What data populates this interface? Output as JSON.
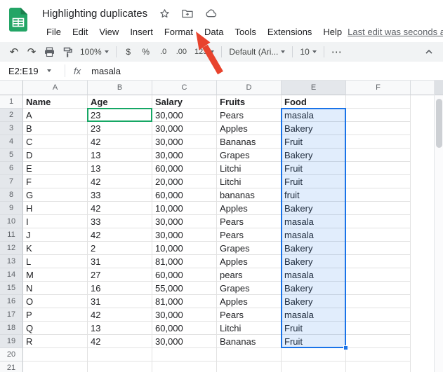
{
  "header": {
    "title": "Highlighting duplicates",
    "last_edit": "Last edit was seconds ago"
  },
  "menus": [
    "File",
    "Edit",
    "View",
    "Insert",
    "Format",
    "Data",
    "Tools",
    "Extensions",
    "Help"
  ],
  "icons": {
    "undo": "↶",
    "redo": "↷",
    "more": "⋯"
  },
  "toolbar": {
    "zoom": "100%",
    "currency": "$",
    "percent": "%",
    "decrease_decimal": ".0",
    "increase_decimal": ".00",
    "number_format": "123",
    "font": "Default (Ari...",
    "font_size": "10"
  },
  "formula_bar": {
    "name_box": "E2:E19",
    "fx_label": "fx",
    "value": "masala"
  },
  "sheet": {
    "column_letters": [
      "A",
      "B",
      "C",
      "D",
      "E",
      "F"
    ],
    "visible_rows": 21,
    "headers": [
      "Name",
      "Age",
      "Salary",
      "Fruits",
      "Food"
    ],
    "rows": [
      [
        "A",
        "23",
        "30,000",
        "Pears",
        "masala"
      ],
      [
        "B",
        "23",
        "30,000",
        "Apples",
        "Bakery"
      ],
      [
        "C",
        "42",
        "30,000",
        "Bananas",
        "Fruit"
      ],
      [
        "D",
        "13",
        "30,000",
        "Grapes",
        "Bakery"
      ],
      [
        "E",
        "13",
        "60,000",
        "Litchi",
        "Fruit"
      ],
      [
        "F",
        "42",
        "20,000",
        "Litchi",
        "Fruit"
      ],
      [
        "G",
        "33",
        "60,000",
        "bananas",
        "fruit"
      ],
      [
        "H",
        "42",
        "10,000",
        "Apples",
        "Bakery"
      ],
      [
        "I",
        "33",
        "30,000",
        "Pears",
        "masala"
      ],
      [
        "J",
        "42",
        "30,000",
        "Pears",
        "masala"
      ],
      [
        "K",
        "2",
        "10,000",
        "Grapes",
        "Bakery"
      ],
      [
        "L",
        "31",
        "81,000",
        "Apples",
        "Bakery"
      ],
      [
        "M",
        "27",
        "60,000",
        "pears",
        "masala"
      ],
      [
        "N",
        "16",
        "55,000",
        "Grapes",
        "Bakery"
      ],
      [
        "O",
        "31",
        "81,000",
        "Apples",
        "Bakery"
      ],
      [
        "P",
        "42",
        "30,000",
        "Pears",
        "masala"
      ],
      [
        "Q",
        "13",
        "60,000",
        "Litchi",
        "Fruit"
      ],
      [
        "R",
        "42",
        "30,000",
        "Bananas",
        "Fruit"
      ]
    ],
    "selection": {
      "range": "E2:E19",
      "col": "E",
      "first_row": 2,
      "last_row": 19
    },
    "green_outline_cell": "B2"
  },
  "colors": {
    "brand_green": "#23a566",
    "brand_green_dark": "#1b7f4d",
    "selection_border": "#1a73e8",
    "selection_fill": "rgba(26,115,232,0.13)",
    "green_cell_border": "#16a765",
    "arrow_red": "#e8432d"
  }
}
